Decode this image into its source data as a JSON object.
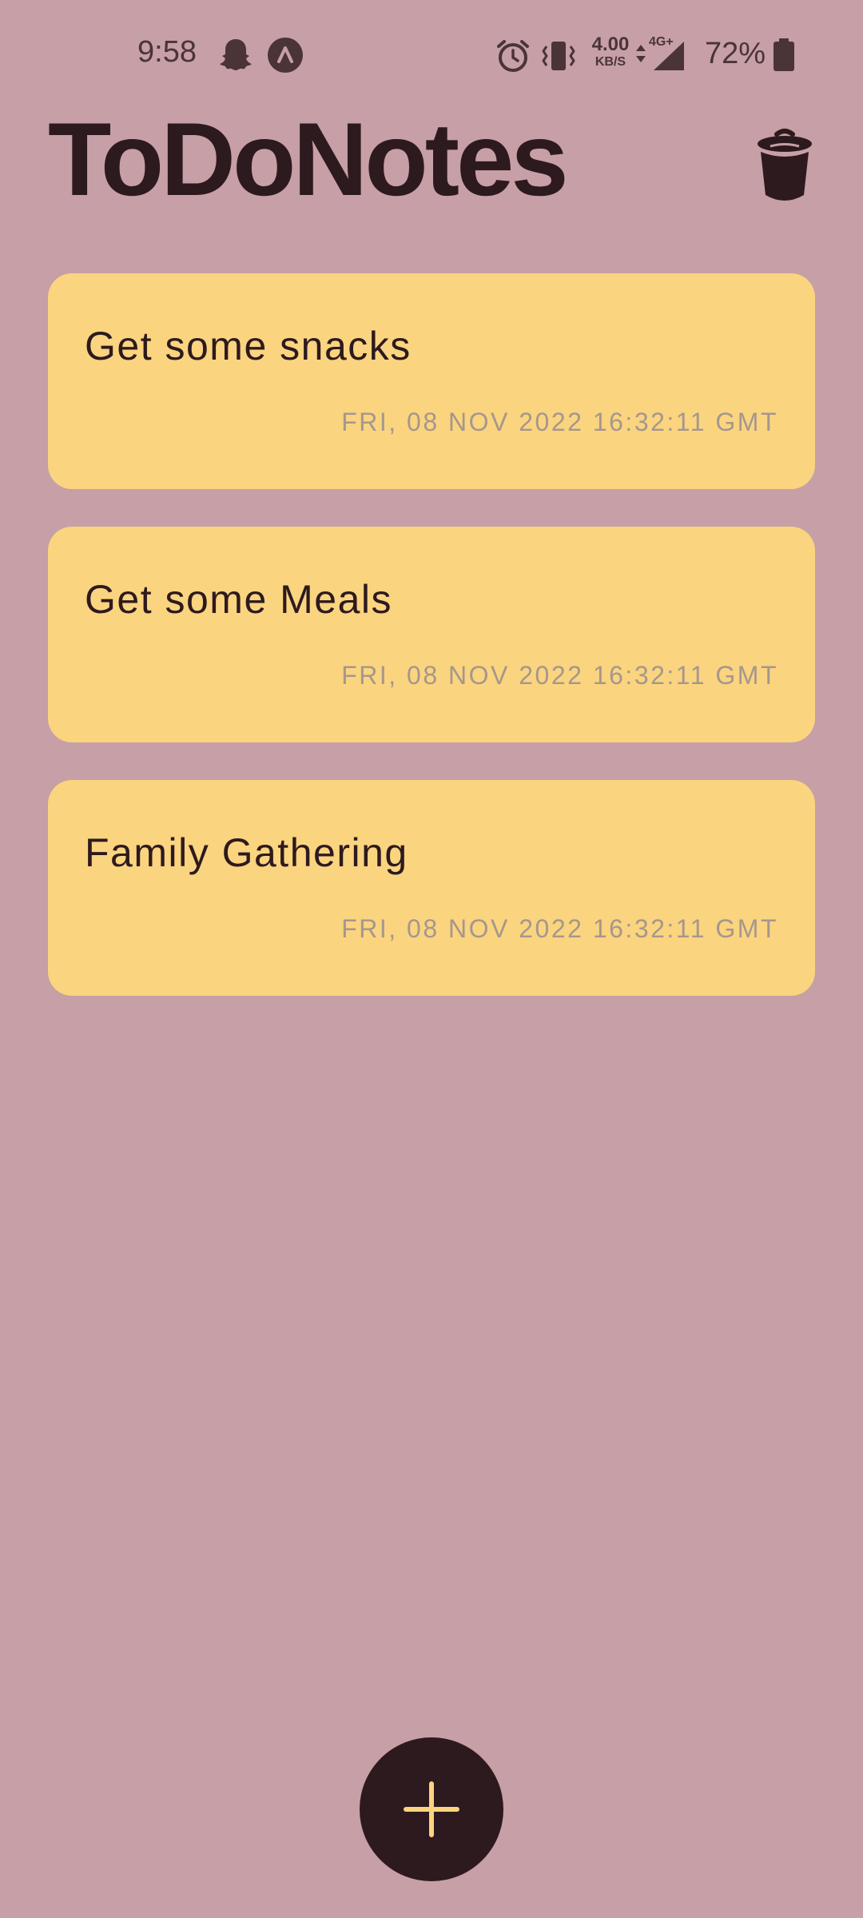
{
  "status_bar": {
    "time": "9:58",
    "net_speed_value": "4.00",
    "net_speed_unit": "KB/S",
    "network_type": "4G+",
    "battery": "72%"
  },
  "header": {
    "title": "ToDoNotes"
  },
  "notes": [
    {
      "title": "Get some snacks",
      "date": "FRI, 08 NOV 2022 16:32:11 GMT"
    },
    {
      "title": "Get some Meals",
      "date": "FRI, 08 NOV 2022 16:32:11 GMT"
    },
    {
      "title": "Family Gathering",
      "date": "FRI, 08 NOV 2022 16:32:11 GMT"
    }
  ],
  "icons": {
    "delete": "trash-icon",
    "add": "plus-icon"
  },
  "colors": {
    "background": "#C79FA6",
    "card": "#FAD47F",
    "text_dark": "#2D1A1E",
    "date_text": "#A5978E",
    "fab_icon": "#FAD47F"
  }
}
